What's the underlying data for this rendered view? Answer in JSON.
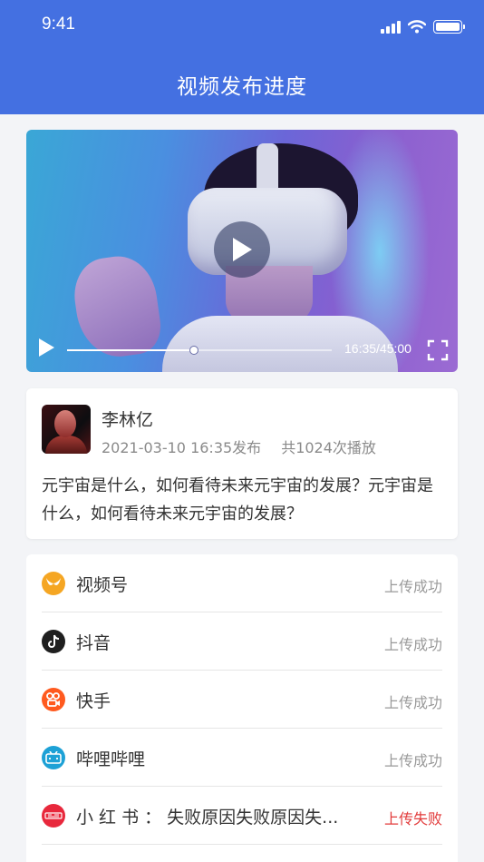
{
  "status_bar": {
    "time": "9:41"
  },
  "header": {
    "title": "视频发布进度"
  },
  "video": {
    "time_display": "16:35/45:00",
    "progress": 0.48
  },
  "author": {
    "name": "李林亿",
    "published": "2021-03-10 16:35发布",
    "plays": "共1024次播放",
    "description": "元宇宙是什么，如何看待未来元宇宙的发展？元宇宙是什么，如何看待未来元宇宙的发展？"
  },
  "platforms": [
    {
      "name": "视频号",
      "status": "上传成功",
      "icon": "wechat-channels-icon",
      "color": "#f5a623",
      "failed": false
    },
    {
      "name": "抖音",
      "status": "上传成功",
      "icon": "douyin-icon",
      "color": "#1f1f1f",
      "failed": false
    },
    {
      "name": "快手",
      "status": "上传成功",
      "icon": "kuaishou-icon",
      "color": "#ff5a1f",
      "failed": false
    },
    {
      "name": "哔哩哔哩",
      "status": "上传成功",
      "icon": "bilibili-icon",
      "color": "#1da1d6",
      "failed": false
    },
    {
      "name": "小 红 书 ： 失败原因失败原因失...",
      "status": "上传失败",
      "icon": "xiaohongshu-icon",
      "color": "#e8283c",
      "failed": true
    }
  ],
  "colors": {
    "brand": "#4470e1",
    "fail": "#e23b3b"
  }
}
